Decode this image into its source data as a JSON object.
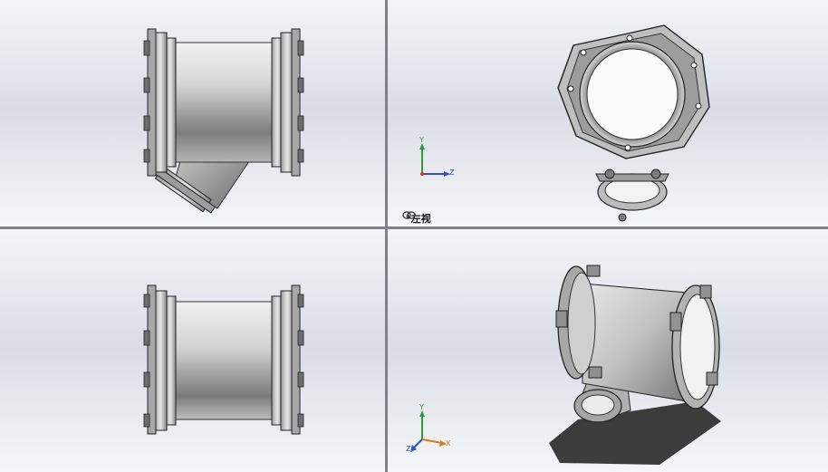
{
  "viewports": {
    "top_left": {
      "name": "front-view"
    },
    "top_right": {
      "name": "left-view",
      "label": "*左视",
      "active": true
    },
    "bottom_left": {
      "name": "top-view"
    },
    "bottom_right": {
      "name": "isometric-view"
    }
  },
  "triad": {
    "y": "Y",
    "z": "Z",
    "x": "X"
  },
  "colors": {
    "y_axis": "#2e9b3a",
    "z_axis": "#2f53c7",
    "x_axis": "#d37a2a",
    "divider": "#7e8188",
    "model_metal": "#c9cacd"
  },
  "icons": {
    "view_link": "link-icon"
  }
}
